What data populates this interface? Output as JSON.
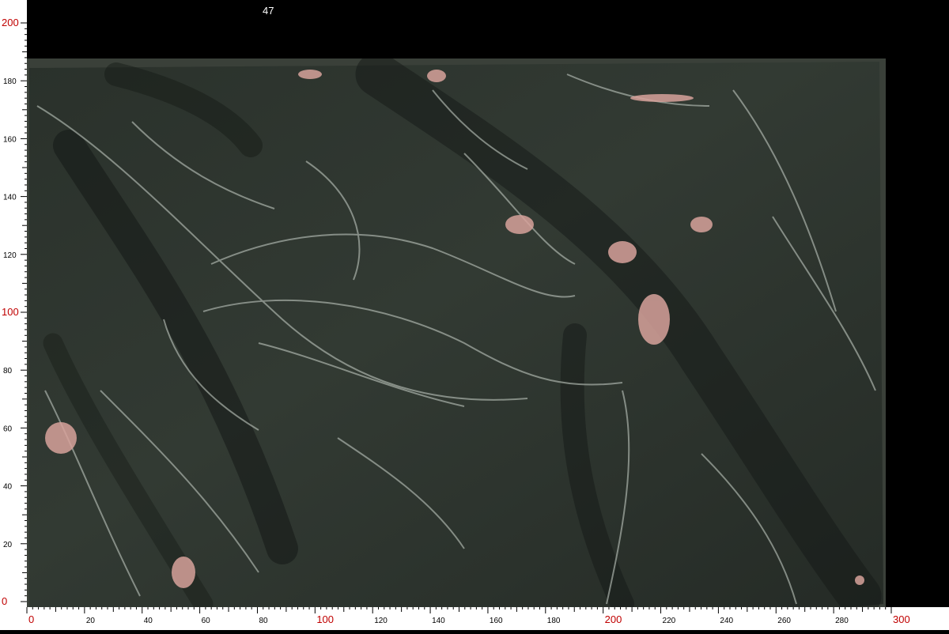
{
  "slab": {
    "number": "47"
  },
  "ruler": {
    "unit_range_x": [
      0,
      300
    ],
    "unit_range_y": [
      0,
      200
    ],
    "x_labels": [
      "0",
      "20",
      "40",
      "60",
      "80",
      "100",
      "120",
      "140",
      "160",
      "180",
      "200",
      "220",
      "240",
      "260",
      "280",
      "300"
    ],
    "y_labels": [
      "0",
      "20",
      "40",
      "60",
      "80",
      "100",
      "120",
      "140",
      "160",
      "180",
      "200"
    ],
    "major_color": "#c00000"
  },
  "colors": {
    "background": "#000000",
    "slab_base": "#2c332d",
    "vein_light": "#b9bfb8",
    "vein_pink": "#d9a6a0"
  }
}
